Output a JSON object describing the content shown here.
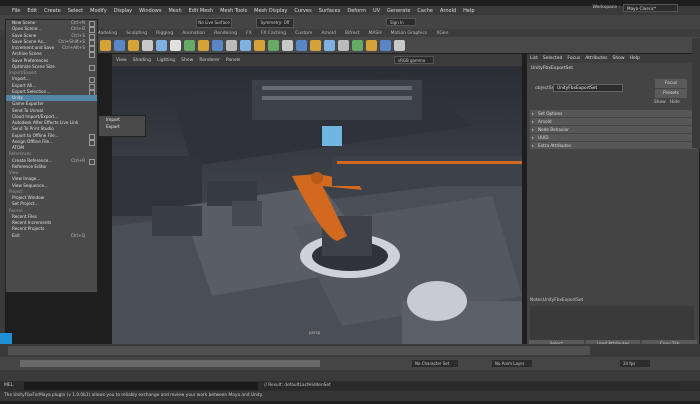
{
  "menubar": {
    "items": [
      "File",
      "Edit",
      "Create",
      "Select",
      "Modify",
      "Display",
      "Windows",
      "Mesh",
      "Edit Mesh",
      "Mesh Tools",
      "Mesh Display",
      "Curves",
      "Surfaces",
      "Deform",
      "UV",
      "Generate",
      "Cache",
      "Arnold",
      "Help"
    ],
    "workspace_label": "Workspace :",
    "workspace_value": "Maya Classic*"
  },
  "statusline": {
    "no_live_surface": "No Live Surface",
    "symmetry": "Symmetry: Off",
    "sign_in": "Sign In"
  },
  "shelf_tabs": [
    "Poly Modeling",
    "Sculpting",
    "Rigging",
    "Animation",
    "Rendering",
    "FX",
    "FX Caching",
    "Custom",
    "Arnold",
    "Bifrost",
    "MASH",
    "Motion Graphics",
    "XGen"
  ],
  "viewport": {
    "menu": [
      "View",
      "Shading",
      "Lighting",
      "Show",
      "Renderer",
      "Panels"
    ],
    "color_space": "sRGB gamma",
    "camera_label": "persp"
  },
  "file_menu": {
    "items": [
      {
        "label": "New Scene",
        "shortcut": "Ctrl+N",
        "box": true
      },
      {
        "label": "Open Scene...",
        "shortcut": "Ctrl+O",
        "box": true
      },
      {
        "label": "Save Scene",
        "shortcut": "Ctrl+S",
        "box": true
      },
      {
        "label": "Save Scene As...",
        "shortcut": "Ctrl+Shift+S",
        "box": true
      },
      {
        "label": "Increment and Save",
        "shortcut": "Ctrl+Alt+S",
        "box": true
      },
      {
        "label": "Archive Scene",
        "shortcut": "",
        "box": true
      },
      {
        "label": "Save Preferences",
        "shortcut": "",
        "box": false
      },
      {
        "label": "Optimize Scene Size",
        "shortcut": "",
        "box": true
      },
      {
        "section": "Import/Export"
      },
      {
        "label": "Import...",
        "shortcut": "",
        "box": true
      },
      {
        "label": "Export All...",
        "shortcut": "",
        "box": true
      },
      {
        "label": "Export Selection...",
        "shortcut": "",
        "box": true
      },
      {
        "label": "Unity",
        "shortcut": "",
        "box": false,
        "highlight": true
      },
      {
        "label": "Game Exporter",
        "shortcut": "",
        "box": false
      },
      {
        "label": "Send To Unreal",
        "shortcut": "",
        "box": false
      },
      {
        "label": "Cloud Import/Export...",
        "shortcut": "",
        "box": false
      },
      {
        "label": "Autodesk After Effects Live Link",
        "shortcut": "",
        "box": false
      },
      {
        "label": "Send To Print Studio",
        "shortcut": "",
        "box": false
      },
      {
        "label": "Export to Offline File...",
        "shortcut": "",
        "box": true
      },
      {
        "label": "Assign Offline File...",
        "shortcut": "",
        "box": true
      },
      {
        "label": "ATOM",
        "shortcut": "",
        "box": false
      },
      {
        "section": "References"
      },
      {
        "label": "Create Reference...",
        "shortcut": "Ctrl+R",
        "box": true
      },
      {
        "label": "Reference Editor",
        "shortcut": "",
        "box": false
      },
      {
        "section": "View"
      },
      {
        "label": "View Image...",
        "shortcut": "",
        "box": false
      },
      {
        "label": "View Sequence...",
        "shortcut": "",
        "box": false
      },
      {
        "section": "Project"
      },
      {
        "label": "Project Window",
        "shortcut": "",
        "box": false
      },
      {
        "label": "Set Project...",
        "shortcut": "",
        "box": false
      },
      {
        "section": "Recent"
      },
      {
        "label": "Recent Files",
        "shortcut": "",
        "box": false
      },
      {
        "label": "Recent Increments",
        "shortcut": "",
        "box": false
      },
      {
        "label": "Recent Projects",
        "shortcut": "",
        "box": false
      },
      {
        "label": "Exit",
        "shortcut": "Ctrl+Q",
        "box": false
      }
    ]
  },
  "unity_submenu": [
    "Import",
    "Export"
  ],
  "right_panel": {
    "tabs": [
      "List",
      "Selected",
      "Focus",
      "Attributes",
      "Show",
      "Help"
    ],
    "node_name": "UnityFbxExportSet",
    "object_set_label": "objectSet:",
    "object_set_value": "UnityFbxExportSet",
    "focus_button": "Focus",
    "presets_button": "Presets",
    "show_label": "Show",
    "hide_label": "Hide",
    "sections": [
      "Set Options",
      "Arnold",
      "Node Behavior",
      "UUID",
      "Extra Attributes"
    ],
    "notes_label": "Notes:",
    "notes_value": "UnityFbxExportSet",
    "buttons": [
      "Select",
      "Load Attributes",
      "Copy Tab"
    ]
  },
  "range_slider": {
    "no_character_set": "No Character Set",
    "no_anim_layer": "No Anim Layer",
    "fps": "24 fps"
  },
  "command_line": {
    "mel_label": "MEL",
    "result": "// Result: defaultLastHiddenSet"
  },
  "help_line": {
    "text": "The UnityFbxForMaya plugin (v 1.0.0b1) allows you to reliably exchange and review your work between Maya and Unity."
  },
  "colors": {
    "highlight": "#5285a6",
    "accent_orange": "#d2691e",
    "panel": "#444444"
  }
}
